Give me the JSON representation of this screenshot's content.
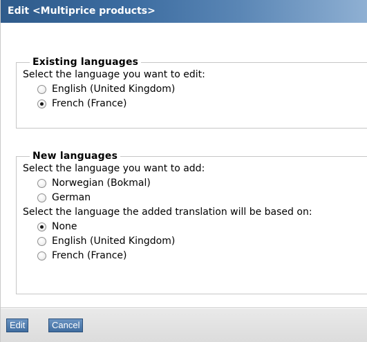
{
  "window": {
    "title": "Edit <Multiprice products>"
  },
  "existing": {
    "legend": "Existing languages",
    "prompt": "Select the language you want to edit:",
    "options": [
      {
        "label": "English (United Kingdom)",
        "checked": false
      },
      {
        "label": "French (France)",
        "checked": true
      }
    ]
  },
  "new_languages": {
    "legend": "New languages",
    "add_prompt": "Select the language you want to add:",
    "add_options": [
      {
        "label": "Norwegian (Bokmal)",
        "checked": false
      },
      {
        "label": "German",
        "checked": false
      }
    ],
    "base_prompt": "Select the language the added translation will be based on:",
    "base_options": [
      {
        "label": "None",
        "checked": true
      },
      {
        "label": "English (United Kingdom)",
        "checked": false
      },
      {
        "label": "French (France)",
        "checked": false
      }
    ]
  },
  "buttons": {
    "edit_label": "Edit",
    "cancel_label": "Cancel"
  },
  "colors": {
    "titlebar_start": "#2f5b8b",
    "titlebar_end": "#8fb0d3",
    "button_bg": "#3f6d9f"
  }
}
